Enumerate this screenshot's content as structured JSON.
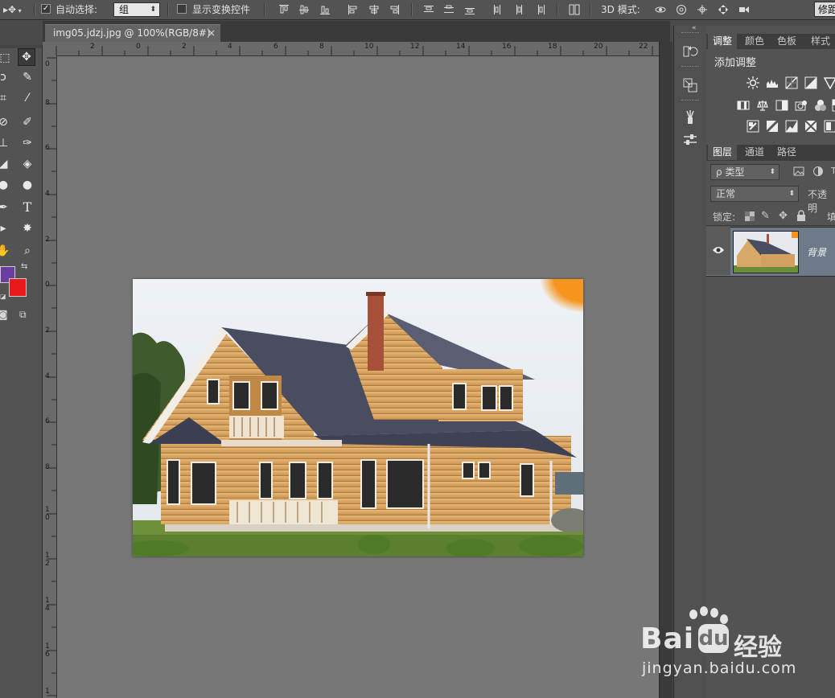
{
  "options_bar": {
    "move_tool_glyph": "▸✥",
    "auto_select_label": "自动选择:",
    "auto_select_checked": true,
    "auto_select_value": "组",
    "show_transform_label": "显示变换控件",
    "show_transform_checked": false,
    "mode_3d_label": "3D 模式:",
    "right_button_label": "修距"
  },
  "document": {
    "tab_title": "img05.jdzj.jpg @ 100%(RGB/8#)",
    "close_glyph": "×"
  },
  "rulers": {
    "horizontal": [
      "2",
      "0",
      "2",
      "4",
      "6",
      "8",
      "10",
      "12",
      "14",
      "16",
      "18",
      "20",
      "22"
    ],
    "vertical": [
      "0",
      "8",
      "6",
      "4",
      "2",
      "0",
      "2",
      "4",
      "6",
      "8",
      "1\n0",
      "1\n2",
      "1\n4",
      "1\n6",
      "1"
    ]
  },
  "colors": {
    "foreground": "#6a3da0",
    "background": "#e8191b",
    "canvas_bg": "#777777",
    "panel_bg": "#535353",
    "selected_layer": "#6c7a8a"
  },
  "adjustments_panel": {
    "tabs": [
      "调整",
      "颜色",
      "色板",
      "样式"
    ],
    "active_tab": "调整",
    "header": "添加调整",
    "icons_row1": [
      "brightness-icon",
      "levels-icon",
      "curves-icon",
      "exposure-icon",
      "vibrance-icon"
    ],
    "icons_row2": [
      "hue-saturation-icon",
      "color-balance-icon",
      "black-white-icon",
      "photo-filter-icon",
      "channel-mixer-icon"
    ],
    "icons_row3": [
      "invert-icon",
      "posterize-icon",
      "threshold-icon",
      "selective-color-icon",
      "gradient-map-icon"
    ]
  },
  "layers_panel": {
    "tabs": [
      "图层",
      "通道",
      "路径"
    ],
    "active_tab": "图层",
    "filter_label": "ρ 类型",
    "blend_mode": "正常",
    "opacity_label": "不透明",
    "lock_label": "锁定:",
    "fill_label": "填",
    "layer_name": "背景"
  },
  "watermark": {
    "brand": "Bai",
    "brand_suffix": "经验",
    "url": "jingyan.baidu.com"
  }
}
